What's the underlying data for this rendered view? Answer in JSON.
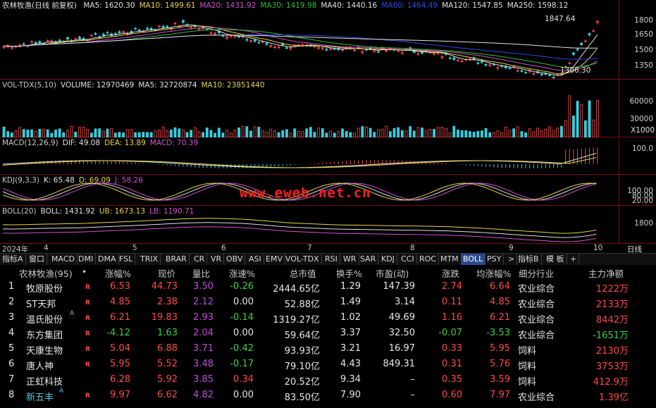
{
  "price": {
    "title": "农林牧渔(日线 前复权)",
    "mas": [
      {
        "label": "MA5: 1620.30",
        "color": "#e0e0e0"
      },
      {
        "label": "MA10: 1499.61",
        "color": "#e8d24a"
      },
      {
        "label": "MA20: 1431.92",
        "color": "#d050d0"
      },
      {
        "label": "MA30: 1419.98",
        "color": "#30c030"
      },
      {
        "label": "MA40: 1440.16",
        "color": "#e0e0e0"
      },
      {
        "label": "MA60: 1464.49",
        "color": "#2c4ae0"
      },
      {
        "label": "MA120: 1547.85",
        "color": "#e0e0e0"
      },
      {
        "label": "MA250: 1598.12",
        "color": "#e0e0e0"
      }
    ],
    "ticks": [
      "1800",
      "1650",
      "1500",
      "1350"
    ],
    "high_label": "1847.64",
    "low_label": "1306.30"
  },
  "volume": {
    "title": [
      {
        "label": "VOL-TDX(5,10)",
        "color": "#c8c8c8"
      },
      {
        "label": "VOLUME: 12970469",
        "color": "#e0e0e0"
      },
      {
        "label": "MA5: 32720874",
        "color": "#e0e0e0"
      },
      {
        "label": "MA10: 23851440",
        "color": "#e8d24a"
      }
    ],
    "ticks": [
      "60000",
      "30000"
    ],
    "unit": "X1000"
  },
  "macd": {
    "title": [
      {
        "label": "MACD(12,26,9)",
        "color": "#c8c8c8"
      },
      {
        "label": "DIF: 49.08",
        "color": "#e0e0e0"
      },
      {
        "label": "DEA: 13.89",
        "color": "#e8d24a"
      },
      {
        "label": "MACD: 70.39",
        "color": "#d050d0"
      }
    ],
    "ticks": [
      "100.0"
    ]
  },
  "kdj": {
    "title": [
      {
        "label": "KDJ(9,3,3)",
        "color": "#c8c8c8"
      },
      {
        "label": "K: 65.48",
        "color": "#e0e0e0"
      },
      {
        "label": "D: 69.09",
        "color": "#e8d24a"
      },
      {
        "label": "J: 58.26",
        "color": "#d050d0"
      }
    ],
    "ticks": [
      "100.00",
      "80.00",
      "20.00"
    ]
  },
  "boll": {
    "title": [
      {
        "label": "BOLL(20)",
        "color": "#c8c8c8"
      },
      {
        "label": "BOLL: 1431.92",
        "color": "#e0e0e0"
      },
      {
        "label": "UB: 1673.13",
        "color": "#e8d24a"
      },
      {
        "label": "LB: 1190.71",
        "color": "#d050d0"
      }
    ],
    "ticks": [
      "1800"
    ]
  },
  "watermark": "www.eweb.net.cn",
  "dates": [
    "2024年",
    "4",
    "5",
    "6",
    "7",
    "8",
    "9",
    "10"
  ],
  "date_right": "日线",
  "tabs": [
    "指标A",
    "窗口",
    "MACD",
    "DMI",
    "DMA",
    "FSL",
    "TRIX",
    "BRAR",
    "CR",
    "VR",
    "OBV",
    "ASI",
    "EMV",
    "VOL-TDX",
    "RSI",
    "WR",
    "SAR",
    "KDJ",
    "CCI",
    "ROC",
    "MTM",
    "BOLL",
    "PSY",
    ">",
    "指标B",
    "模 板",
    "+"
  ],
  "active_tab": "BOLL",
  "table": {
    "headers": [
      "农林牧渔(95)",
      "•",
      "涨幅%",
      "现价",
      "量比",
      "涨速%",
      "总市值",
      "换手%",
      "市盈(动)",
      "涨跌",
      "均涨幅%",
      "细分行业",
      "主力净额"
    ],
    "rows": [
      {
        "no": "1",
        "name": "牧原股份",
        "mark": "",
        "r": "R",
        "chg": "6.53",
        "price": "44.73",
        "vr": "3.50",
        "speed": "-0.26",
        "cap": "2444.65亿",
        "turn": "1.29",
        "pe": "147.39",
        "diff": "2.74",
        "avg": "6.64",
        "ind": "农业综合",
        "net": "1222万"
      },
      {
        "no": "2",
        "name": "ST天邦",
        "mark": "",
        "r": "R",
        "chg": "4.85",
        "price": "2.38",
        "vr": "2.12",
        "speed": "0.00",
        "cap": "52.88亿",
        "turn": "1.49",
        "pe": "3.14",
        "diff": "0.11",
        "avg": "4.85",
        "ind": "农业综合",
        "net": "2133万"
      },
      {
        "no": "3",
        "name": "温氏股份",
        "mark": "A",
        "r": "R",
        "chg": "6.21",
        "price": "19.83",
        "vr": "2.93",
        "speed": "-0.14",
        "cap": "1319.27亿",
        "turn": "1.02",
        "pe": "49.69",
        "diff": "1.16",
        "avg": "6.21",
        "ind": "农业综合",
        "net": "8442万"
      },
      {
        "no": "4",
        "name": "东方集团",
        "mark": "",
        "r": "R",
        "chg": "-4.12",
        "price": "1.63",
        "vr": "2.04",
        "speed": "0.00",
        "cap": "59.64亿",
        "turn": "3.37",
        "pe": "32.50",
        "diff": "-0.07",
        "avg": "-3.53",
        "ind": "农业综合",
        "net": "-1651万"
      },
      {
        "no": "5",
        "name": "天康生物",
        "mark": "",
        "r": "R",
        "chg": "5.04",
        "price": "6.88",
        "vr": "3.71",
        "speed": "-0.42",
        "cap": "93.93亿",
        "turn": "3.21",
        "pe": "16.97",
        "diff": "0.33",
        "avg": "5.95",
        "ind": "饲料",
        "net": "2130万"
      },
      {
        "no": "6",
        "name": "唐人神",
        "mark": "",
        "r": "R",
        "chg": "5.95",
        "price": "5.52",
        "vr": "3.48",
        "speed": "-0.17",
        "cap": "79.10亿",
        "turn": "4.43",
        "pe": "849.31",
        "diff": "0.31",
        "avg": "5.76",
        "ind": "饲料",
        "net": "3753万"
      },
      {
        "no": "7",
        "name": "正虹科技",
        "mark": "",
        "r": "",
        "chg": "6.28",
        "price": "5.92",
        "vr": "3.85",
        "speed": "0.34",
        "cap": "20.52亿",
        "turn": "9.34",
        "pe": "–",
        "diff": "0.35",
        "avg": "3.59",
        "ind": "饲料",
        "net": "412.9万"
      },
      {
        "no": "8",
        "name": "新五丰",
        "mark": "A",
        "r": "R",
        "chg": "9.97",
        "price": "6.62",
        "vr": "4.82",
        "speed": "0.00",
        "cap": "83.50亿",
        "turn": "7.90",
        "pe": "–",
        "diff": "0.60",
        "avg": "7.97",
        "ind": "农业综合",
        "net": "1.39亿"
      }
    ]
  },
  "colors": {
    "up": "#ff4a4a",
    "down": "#3cd23c",
    "grid": "#7a1010",
    "bg": "#000000"
  }
}
